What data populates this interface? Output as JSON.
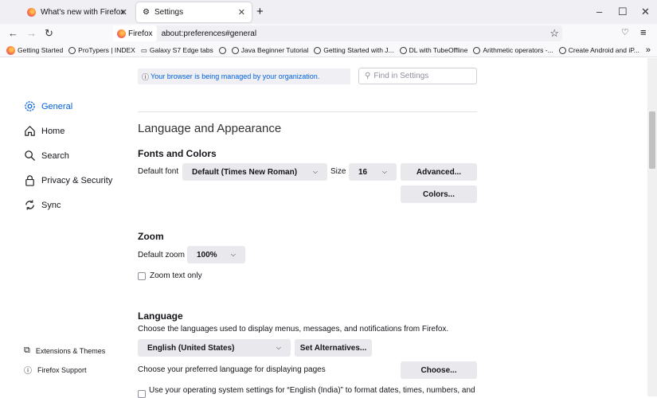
{
  "tabs": [
    {
      "title": "What's new with Firefox",
      "icon": "firefox-icon"
    },
    {
      "title": "Settings",
      "icon": "gear-icon",
      "active": true
    }
  ],
  "window": {
    "minimize": "–",
    "maximize": "☐",
    "close": "✕"
  },
  "nav": {
    "identity": "Firefox",
    "url": "about:preferences#general"
  },
  "bookmarks": [
    "Getting Started",
    "ProTypers | INDEX",
    "Galaxy S7 Edge tabs",
    "",
    "Java Beginner Tutorial",
    "Getting Started with J...",
    "DL with TubeOffline",
    "Arithmetic operators -...",
    "Create Android and iP..."
  ],
  "sidebar": {
    "items": [
      {
        "label": "General",
        "active": true
      },
      {
        "label": "Home"
      },
      {
        "label": "Search"
      },
      {
        "label": "Privacy & Security"
      },
      {
        "label": "Sync"
      }
    ],
    "footer": [
      "Extensions & Themes",
      "Firefox Support"
    ]
  },
  "notice": "Your browser is being managed by your organization.",
  "search": {
    "placeholder": "Find in Settings"
  },
  "section_title": "Language and Appearance",
  "fonts": {
    "heading": "Fonts and Colors",
    "default_font_label": "Default font",
    "default_font": "Default (Times New Roman)",
    "size_label": "Size",
    "size": "16",
    "advanced": "Advanced...",
    "colors": "Colors..."
  },
  "zoom": {
    "heading": "Zoom",
    "default_zoom_label": "Default zoom",
    "default_zoom": "100%",
    "zoom_text_only": "Zoom text only",
    "zoom_text_only_checked": false
  },
  "language": {
    "heading": "Language",
    "description": "Choose the languages used to display menus, messages, and notifications from Firefox.",
    "selected": "English (United States)",
    "set_alternatives": "Set Alternatives...",
    "pages_label": "Choose your preferred language for displaying pages",
    "choose": "Choose...",
    "os_settings": "Use your operating system settings for “English (India)” to format dates, times, numbers, and"
  },
  "colors": {
    "accent": "#0061e0",
    "link": "#0a84ff"
  }
}
